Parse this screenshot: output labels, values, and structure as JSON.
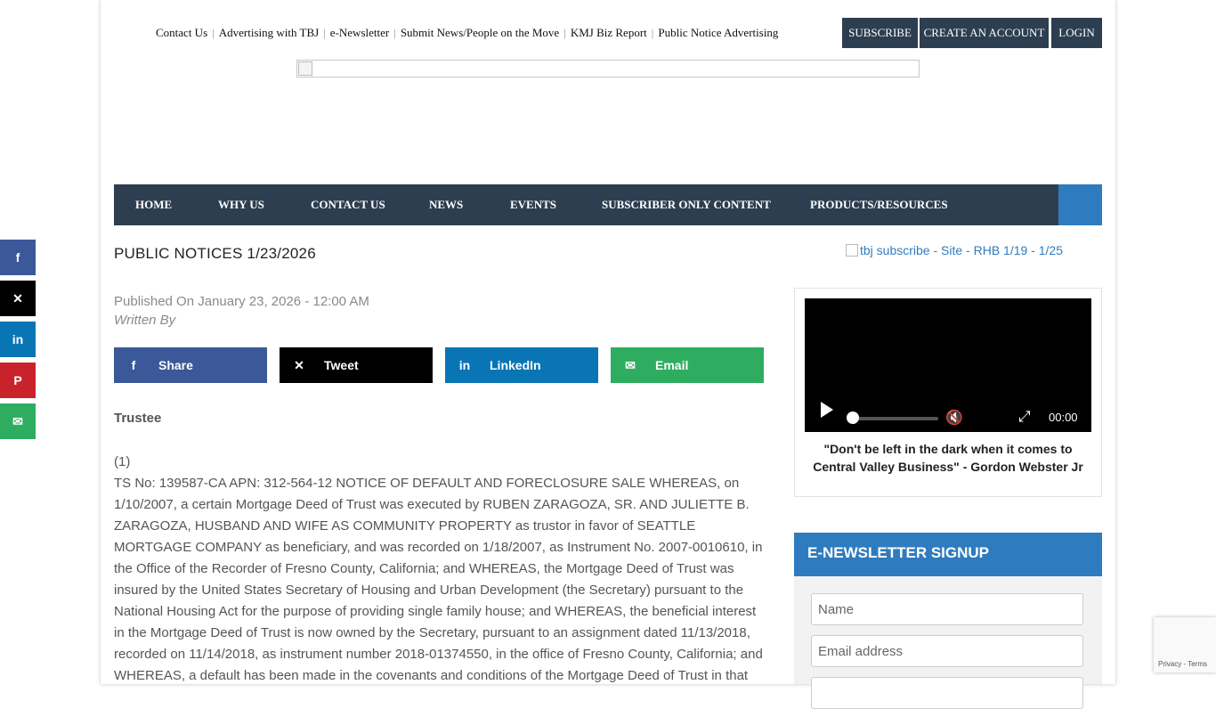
{
  "top_links": [
    "Contact Us",
    "Advertising with TBJ",
    "e-Newsletter",
    "Submit News/People on the Move",
    "KMJ Biz Report",
    "Public Notice Advertising"
  ],
  "account_buttons": {
    "subscribe": "SUBSCRIBE",
    "create": "CREATE AN ACCOUNT",
    "login": "LOGIN"
  },
  "nav": [
    "HOME",
    "WHY US",
    "CONTACT US",
    "NEWS",
    "EVENTS",
    "SUBSCRIBER ONLY CONTENT",
    "PRODUCTS/RESOURCES"
  ],
  "article": {
    "title": "PUBLIC NOTICES 1/23/2026",
    "published": "Published On January 23, 2026 - 12:00 AM",
    "written_by": "Written By",
    "section": "Trustee",
    "number": "(1)",
    "body": "TS No: 139587-CA APN: 312-564-12 NOTICE OF DEFAULT AND FORECLOSURE SALE WHEREAS, on 1/10/2007, a certain Mortgage Deed of Trust was executed by RUBEN ZARAGOZA, SR. AND JULIETTE B. ZARAGOZA, HUSBAND AND WIFE AS COMMUNITY PROPERTY as trustor in favor of SEATTLE MORTGAGE COMPANY as beneficiary, and was recorded on 1/18/2007, as Instrument No. 2007-0010610, in the Office of the Recorder of Fresno County, California; and WHEREAS, the Mortgage Deed of Trust was insured by the United States Secretary of Housing and Urban Development (the Secretary) pursuant to the National Housing Act for the purpose of providing single family house; and WHEREAS, the beneficial interest in the Mortgage Deed of Trust is now owned by the Secretary, pursuant to an assignment dated 11/13/2018, recorded on 11/14/2018, as instrument number 2018-01374550, in the office of Fresno County, California; and WHEREAS, a default has been made in the covenants and conditions of the Mortgage Deed of Trust in that"
  },
  "share_buttons": [
    {
      "label": "Share",
      "icon": "facebook-icon",
      "color": "#3b5998"
    },
    {
      "label": "Tweet",
      "icon": "x-icon",
      "color": "#000000"
    },
    {
      "label": "LinkedIn",
      "icon": "linkedin-icon",
      "color": "#0a75b5"
    },
    {
      "label": "Email",
      "icon": "email-icon",
      "color": "#2ead60"
    }
  ],
  "sidebar": {
    "ad_alt": "tbj subscribe - Site - RHB 1/19 - 1/25",
    "video_time": "00:00",
    "video_progress": 0,
    "video_quote": "\"Don't be left in the dark when it comes to Central Valley Business\" - Gordon Webster Jr",
    "newsletter_title": "E-NEWSLETTER SIGNUP",
    "name_placeholder": "Name",
    "email_placeholder": "Email address"
  },
  "social_rail": [
    {
      "icon": "facebook-icon",
      "color": "#3b5998"
    },
    {
      "icon": "x-icon",
      "color": "#000000"
    },
    {
      "icon": "linkedin-icon",
      "color": "#0a75b5"
    },
    {
      "icon": "pinterest-icon",
      "color": "#c8232c"
    },
    {
      "icon": "email-icon",
      "color": "#2ead60"
    }
  ],
  "recaptcha": {
    "privacy": "Privacy",
    "terms": "Terms"
  }
}
